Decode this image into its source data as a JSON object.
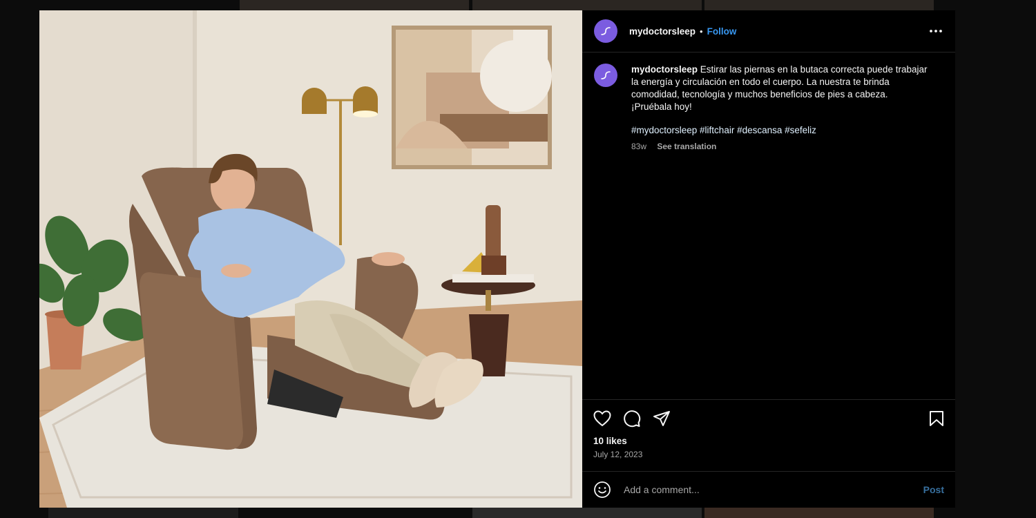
{
  "post": {
    "username": "mydoctorsleep",
    "separator": "•",
    "follow_label": "Follow",
    "caption": "Estirar las piernas en la butaca correcta puede trabajar la energía y circulación en todo el cuerpo. La nuestra te brinda comodidad, tecnología y muchos beneficios de pies a cabeza. ¡Pruébala hoy!",
    "hashtags": "#mydoctorsleep #liftchair #descansa #sefeliz",
    "age": "83w",
    "see_translation": "See translation",
    "likes": "10 likes",
    "date": "July 12, 2023"
  },
  "comment": {
    "placeholder": "Add a comment...",
    "post_label": "Post"
  },
  "colors": {
    "accent": "#3897f0",
    "avatar": "#7b5ce0",
    "background": "#000000"
  },
  "icons": [
    "more-options-icon",
    "heart-icon",
    "comment-icon",
    "share-icon",
    "bookmark-icon",
    "emoji-icon"
  ]
}
